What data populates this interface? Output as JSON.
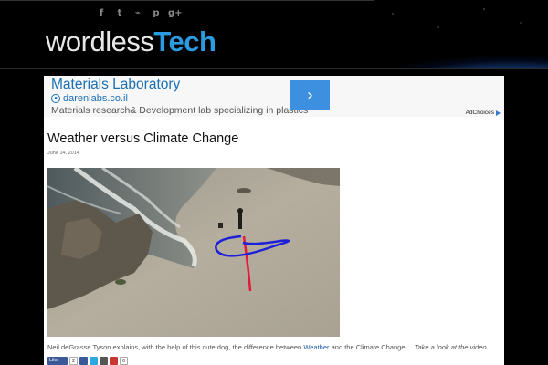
{
  "header": {
    "logo_part1": "wordless",
    "logo_part2": "Tech",
    "social": [
      {
        "icon": "facebook-icon",
        "glyph": "f"
      },
      {
        "icon": "twitter-icon",
        "glyph": "t"
      },
      {
        "icon": "rss-icon",
        "glyph": "⌁"
      },
      {
        "icon": "pinterest-icon",
        "glyph": "p"
      },
      {
        "icon": "google-plus-icon",
        "glyph": "g+"
      }
    ]
  },
  "ad": {
    "title": "Materials Laboratory",
    "domain": "darenlabs.co.il",
    "description": "Materials research& Development lab specializing in plastics",
    "arrow": "›",
    "adchoices": "AdChoices"
  },
  "post": {
    "title": "Weather versus Climate Change",
    "date": "June 14, 2014",
    "caption_before": "Neil deGrasse Tyson explains, with the help of this cute dog, the difference between ",
    "caption_link": "Weather",
    "caption_after": " and the Climate Change.",
    "caption_more": "Take a look at the video…",
    "share": {
      "like_label": "Like",
      "like_count": "2"
    }
  },
  "colors": {
    "accent": "#2a9be0",
    "ad_button": "#3d8fe0",
    "link": "#1f5fa8",
    "facebook": "#3b5998"
  }
}
